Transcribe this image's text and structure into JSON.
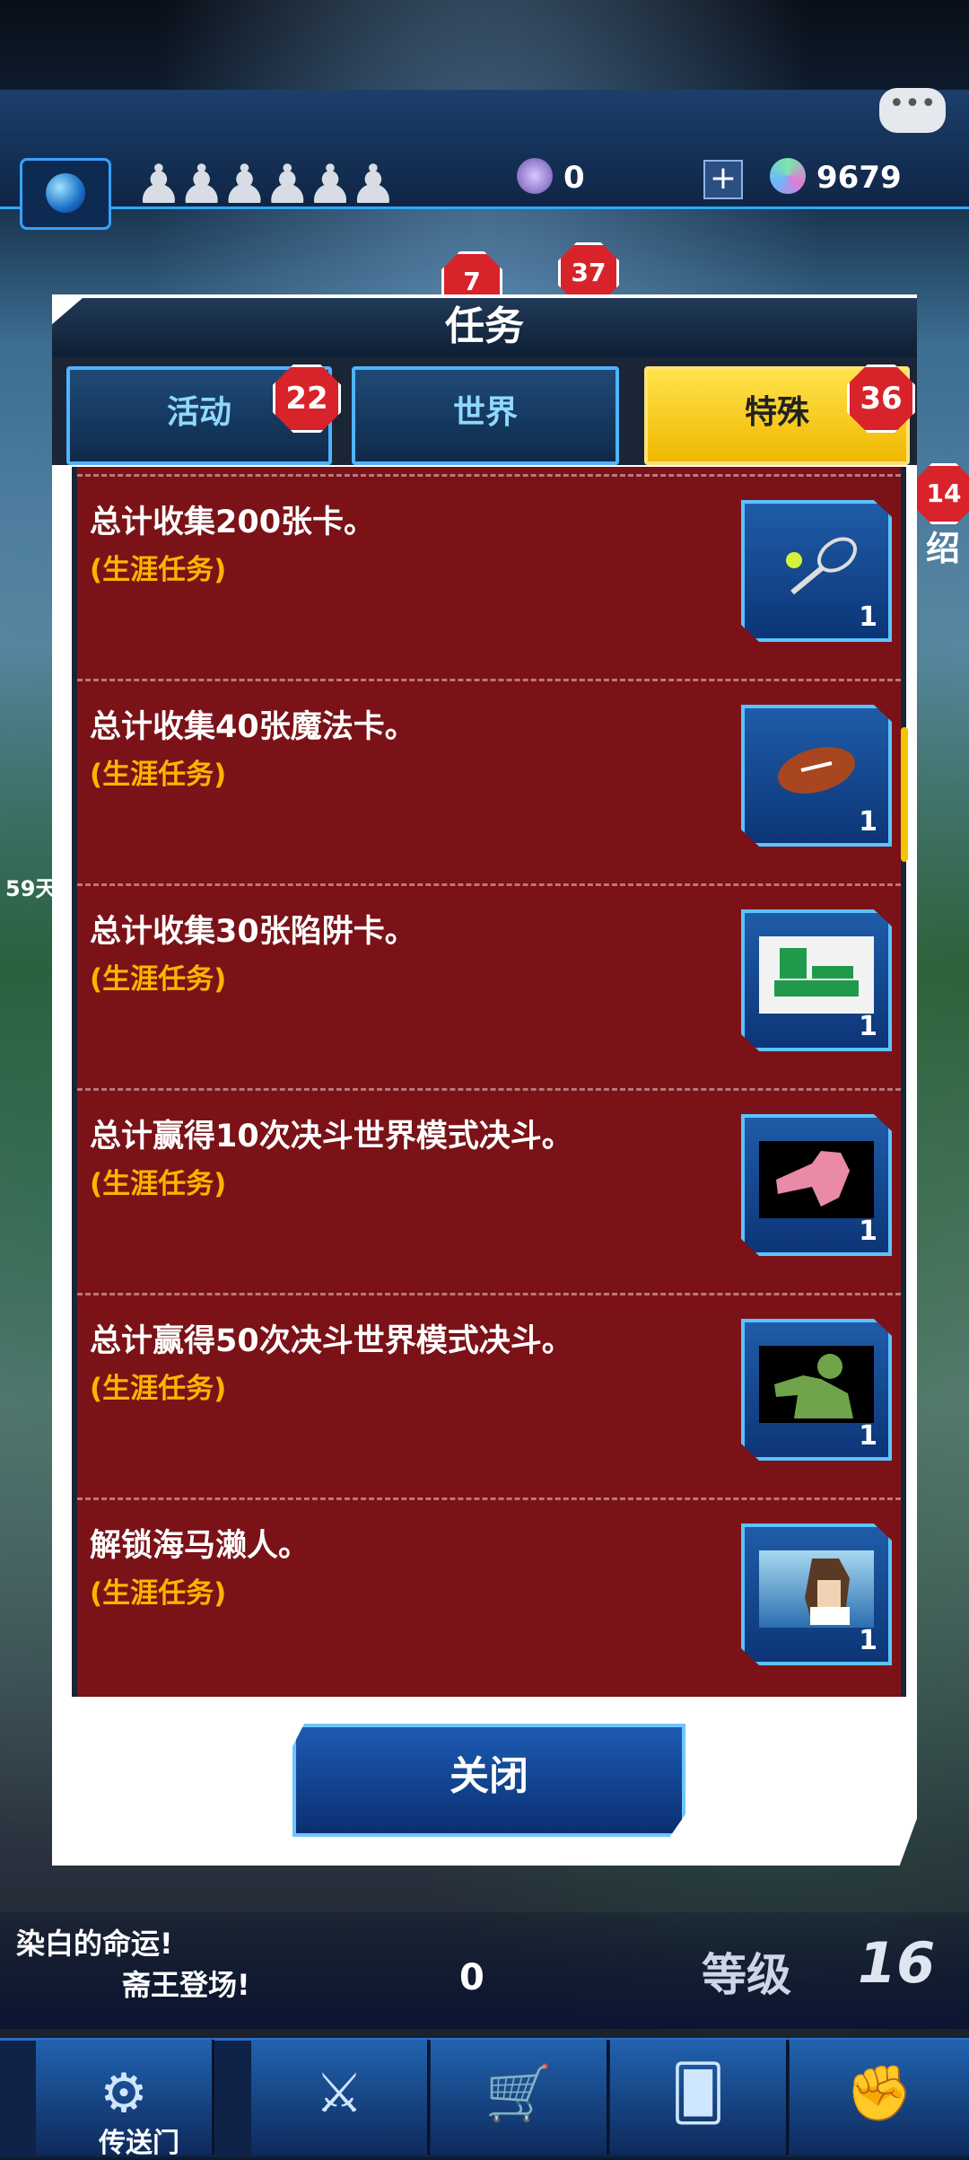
{
  "hud": {
    "icon": "globe-icon",
    "crystals": "0",
    "gems": "9679",
    "badge_a": "7",
    "badge_b": "37",
    "side_badge": "14",
    "side_label": "绍",
    "side_label2": "59天"
  },
  "dialog": {
    "title": "任务",
    "tabs": [
      {
        "label": "活动",
        "badge": "22"
      },
      {
        "label": "世界",
        "badge": ""
      },
      {
        "label": "特殊",
        "badge": "36"
      }
    ],
    "missions": [
      {
        "title": "总计收集200张卡。",
        "subtitle": "(生涯任务)",
        "reward_icon": "tennis-racket-icon",
        "count": "1"
      },
      {
        "title": "总计收集40张魔法卡。",
        "subtitle": "(生涯任务)",
        "reward_icon": "football-icon",
        "count": "1"
      },
      {
        "title": "总计收集30张陷阱卡。",
        "subtitle": "(生涯任务)",
        "reward_icon": "duel-field-icon",
        "count": "1"
      },
      {
        "title": "总计赢得10次决斗世界模式决斗。",
        "subtitle": "(生涯任务)",
        "reward_icon": "pink-silhouette-icon",
        "count": "1"
      },
      {
        "title": "总计赢得50次决斗世界模式决斗。",
        "subtitle": "(生涯任务)",
        "reward_icon": "green-silhouette-icon",
        "count": "1"
      },
      {
        "title": "解锁海马濑人。",
        "subtitle": "(生涯任务)",
        "reward_icon": "kaiba-portrait-icon",
        "count": "1"
      }
    ],
    "close_label": "关闭"
  },
  "bottom": {
    "banner": "染白的命运!",
    "banner2": "斋王登场!",
    "count": "0",
    "level_label": "等级",
    "level": "16",
    "nav_label": "传送门"
  }
}
